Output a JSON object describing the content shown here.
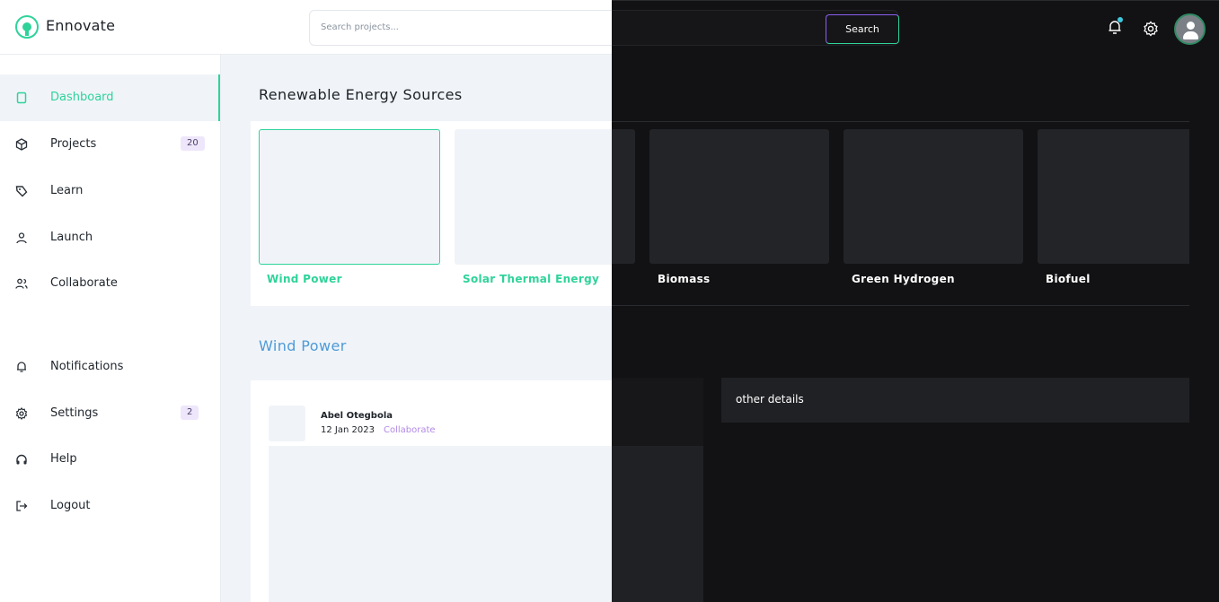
{
  "app": {
    "name": "Ennovate"
  },
  "search": {
    "placeholder": "Search projects...",
    "button_label": "Search"
  },
  "sidebar": {
    "items": [
      {
        "label": "Dashboard",
        "icon": "dashboard-icon",
        "active": true
      },
      {
        "label": "Projects",
        "icon": "cube-icon",
        "badge": "20"
      },
      {
        "label": "Learn",
        "icon": "tag-icon"
      },
      {
        "label": "Launch",
        "icon": "user-icon"
      },
      {
        "label": "Collaborate",
        "icon": "users-icon"
      },
      {
        "label": "Notifications",
        "icon": "bell-icon"
      },
      {
        "label": "Settings",
        "icon": "gear-icon",
        "badge": "2"
      },
      {
        "label": "Help",
        "icon": "headphones-icon"
      },
      {
        "label": "Logout",
        "icon": "logout-icon"
      }
    ]
  },
  "main": {
    "section_title": "Renewable Energy Sources",
    "sources": [
      {
        "label": "Wind Power",
        "selected": true
      },
      {
        "label": "Solar Thermal Energy"
      },
      {
        "label": "Biomass"
      },
      {
        "label": "Green Hydrogen"
      },
      {
        "label": "Biofuel"
      }
    ],
    "detail_title": "Wind Power",
    "post": {
      "author": "Abel Otegbola",
      "date": "12 Jan 2023",
      "action": "Collaborate"
    },
    "other_details": "other details"
  },
  "colors": {
    "accent": "#2fd39a",
    "purple": "#8a5ef0",
    "dark_bg": "#121214",
    "light_bg": "#f0f4f8"
  }
}
